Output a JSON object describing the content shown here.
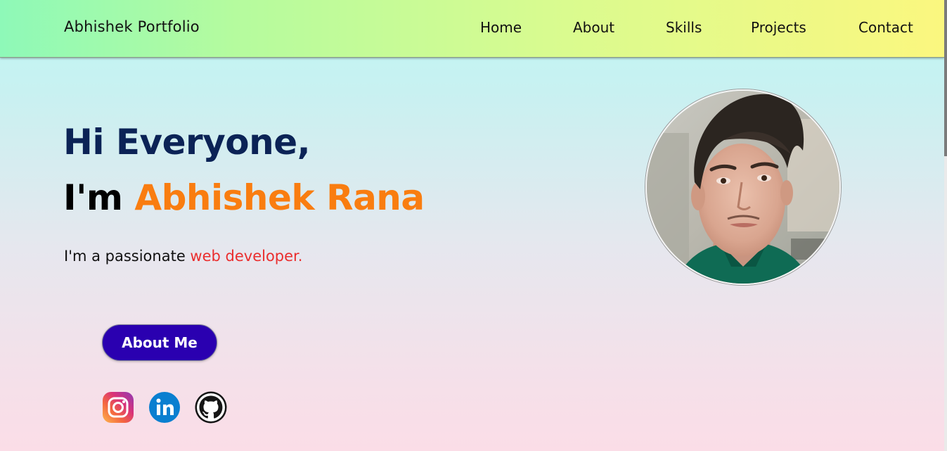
{
  "navbar": {
    "brand": "Abhishek Portfolio",
    "links": [
      "Home",
      "About",
      "Skills",
      "Projects",
      "Contact"
    ]
  },
  "hero": {
    "greeting": "Hi Everyone,",
    "intro_prefix": "I'm ",
    "name": "Abhishek Rana",
    "tagline_prefix": "I'm a passionate ",
    "tagline_role": "web developer.",
    "about_button": "About Me"
  },
  "social": [
    {
      "icon": "instagram-icon",
      "color": "#e1306c"
    },
    {
      "icon": "linkedin-icon",
      "color": "#0a7fd0"
    },
    {
      "icon": "github-icon",
      "color": "#111111"
    }
  ],
  "colors": {
    "greeting": "#0b2356",
    "name": "#f97d10",
    "role": "#ea2e2e",
    "button": "#2a00b0"
  }
}
